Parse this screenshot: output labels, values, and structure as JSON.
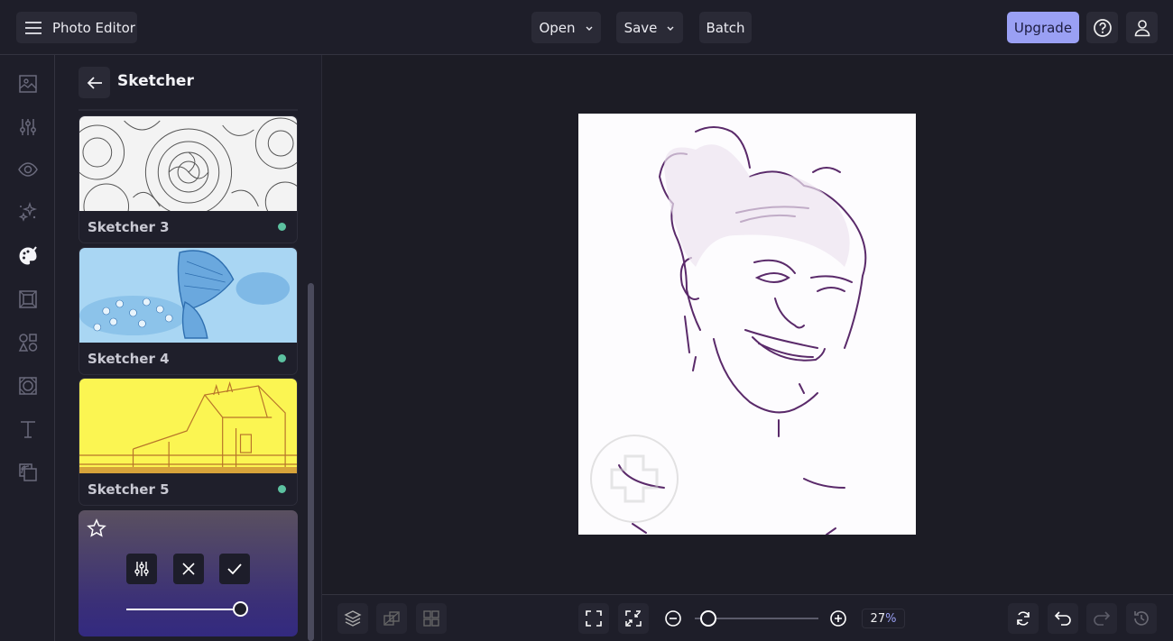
{
  "app": {
    "title": "Photo Editor"
  },
  "topbar": {
    "menu_label": "Photo Editor",
    "open_label": "Open",
    "save_label": "Save",
    "batch_label": "Batch",
    "upgrade_label": "Upgrade",
    "accent_color": "#9aa0f4"
  },
  "rail": {
    "items": [
      {
        "icon": "image-icon",
        "label": "Image"
      },
      {
        "icon": "sliders-icon",
        "label": "Adjust"
      },
      {
        "icon": "eye-icon",
        "label": "Effects"
      },
      {
        "icon": "sparkle-icon",
        "label": "Touch Up"
      },
      {
        "icon": "palette-icon",
        "label": "Artsy",
        "active": true
      },
      {
        "icon": "frame-icon",
        "label": "Frames"
      },
      {
        "icon": "shapes-icon",
        "label": "Graphics"
      },
      {
        "icon": "texture-icon",
        "label": "Textures"
      },
      {
        "icon": "text-icon",
        "label": "Text"
      },
      {
        "icon": "overlay-icon",
        "label": "Overlays"
      }
    ]
  },
  "panel": {
    "title": "Sketcher",
    "cards": [
      {
        "label": "Sketcher 3",
        "theme": "roses-sketch",
        "premium_dot_color": "#5cc1a0"
      },
      {
        "label": "Sketcher 4",
        "theme": "blue-butterfly",
        "premium_dot_color": "#5cc1a0"
      },
      {
        "label": "Sketcher 5",
        "theme": "yellow-barn",
        "premium_dot_color": "#5cc1a0"
      }
    ],
    "active_effect": {
      "strength": 1.0
    }
  },
  "canvas": {
    "image_description": "purple line sketch portrait of smiling person",
    "watermark": "BeFunky Plus"
  },
  "bottombar": {
    "zoom_value": "27",
    "zoom_unit": "%",
    "zoom_slider_fraction": 0.05
  }
}
